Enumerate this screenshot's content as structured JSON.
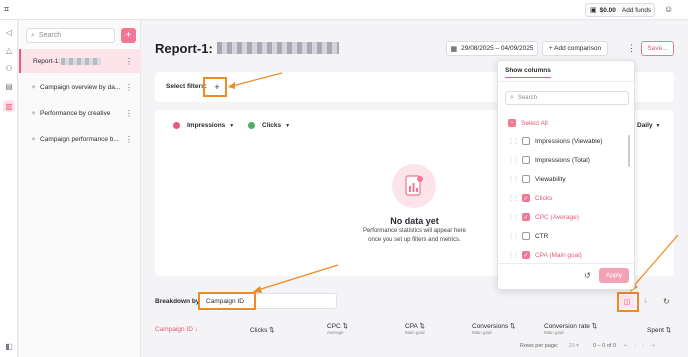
{
  "topbar": {
    "logo_icon": "key-logo-icon",
    "balance": "$0.00",
    "add_funds_label": "Add funds"
  },
  "sidebar": {
    "search_placeholder": "Search",
    "reports": [
      {
        "label": "Report-1:"
      },
      {
        "label": "Campaign overview by da..."
      },
      {
        "label": "Performance by creative"
      },
      {
        "label": "Campaign performance b..."
      }
    ]
  },
  "header": {
    "title": "Report-1:",
    "date_range": "29/08/2025 – 04/09/2025",
    "add_comparison_label": "+ Add comparison",
    "save_label": "Save..."
  },
  "filters": {
    "label": "Select filters:",
    "add_label": "+"
  },
  "chart": {
    "metric1": "Impressions",
    "metric2": "Clicks",
    "granularity": "Daily",
    "empty_title": "No data yet",
    "empty_line1": "Performance statistics will appear here",
    "empty_line2": "once you set up filters and metrics.",
    "metric1_color": "#e8587a",
    "metric2_color": "#4caf6a"
  },
  "breakdown": {
    "label": "Breakdown by:",
    "value": "Campaign ID"
  },
  "table": {
    "columns": [
      {
        "label": "Campaign ID",
        "sub": ""
      },
      {
        "label": "Clicks",
        "sub": ""
      },
      {
        "label": "CPC",
        "sub": "Average"
      },
      {
        "label": "CPA",
        "sub": "Main goal"
      },
      {
        "label": "Conversions",
        "sub": "Main goal"
      },
      {
        "label": "Conversion rate",
        "sub": "Main goal"
      },
      {
        "label": "Spent",
        "sub": ""
      }
    ],
    "rows_per_page_label": "Rows per page:",
    "rows_per_page_value": "20",
    "range_text": "0 – 0 of 0"
  },
  "columns_panel": {
    "tab_label": "Show columns",
    "search_placeholder": "Search",
    "select_all_label": "Select All",
    "items": [
      {
        "label": "Impressions (Viewable)",
        "checked": false
      },
      {
        "label": "Impressions (Total)",
        "checked": false
      },
      {
        "label": "Viewability",
        "checked": false
      },
      {
        "label": "Clicks",
        "checked": true
      },
      {
        "label": "CPC (Average)",
        "checked": true
      },
      {
        "label": "CTR",
        "checked": false
      },
      {
        "label": "CPA (Main goal)",
        "checked": true
      }
    ],
    "apply_label": "Apply"
  },
  "colors": {
    "accent": "#f07894",
    "highlight": "#f08a24"
  }
}
